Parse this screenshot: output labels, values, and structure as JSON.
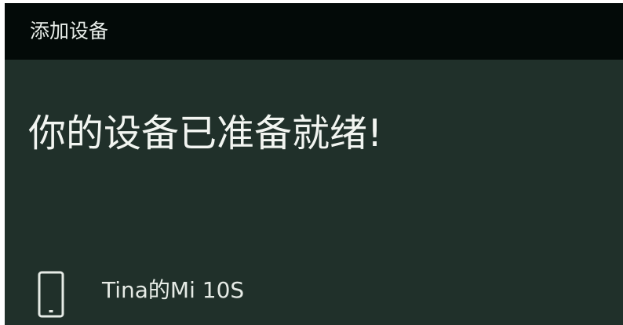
{
  "window": {
    "title": "添加设备"
  },
  "main": {
    "headline": "你的设备已准备就绪!",
    "device": {
      "name": "Tina的Mi 10S",
      "icon": "phone-icon"
    }
  },
  "colors": {
    "titlebar_bg": "#030a08",
    "content_bg": "#20302a",
    "text": "#f2f5f1"
  }
}
